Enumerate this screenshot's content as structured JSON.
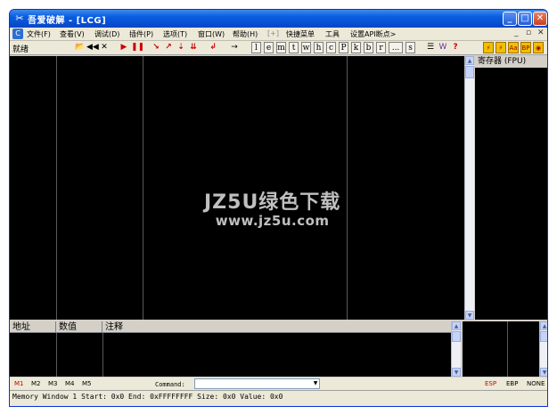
{
  "window": {
    "title": "吾爱破解 - [LCG]",
    "controls": {
      "minimize": "_",
      "maximize": "□",
      "close": "✕"
    }
  },
  "menu": {
    "items": [
      "文件(F)",
      "查看(V)",
      "调试(D)",
      "插件(P)",
      "选项(T)",
      "窗口(W)",
      "帮助(H)",
      "[+]",
      "快捷菜单",
      "工具",
      "设置API断点>"
    ],
    "mdi": [
      "_",
      "▫",
      "✕"
    ]
  },
  "toolbar": {
    "status": "就绪",
    "buttons": [
      "📂",
      "◀◀",
      "✕",
      "▶",
      "❚❚",
      "↘",
      "↗",
      "⇣",
      "⇊",
      "↲",
      "→",
      "l",
      "e",
      "m",
      "t",
      "w",
      "h",
      "c",
      "P",
      "k",
      "b",
      "r",
      "...",
      "s",
      "☰",
      "W",
      "?"
    ],
    "right_buttons": [
      "⚡",
      "⚡",
      "Aa",
      "BP",
      "◉"
    ]
  },
  "registers": {
    "header": "寄存器 (FPU)"
  },
  "dump": {
    "columns": [
      "地址",
      "数值",
      "注释"
    ]
  },
  "watermark": {
    "line1": "JZ5U绿色下载",
    "line2": "www.jz5u.com"
  },
  "bottom": {
    "memory_tabs": [
      "M1",
      "M2",
      "M3",
      "M4",
      "M5"
    ],
    "command_label": "Command:",
    "command_value": "",
    "register_selectors": [
      "ESP",
      "EBP",
      "NONE"
    ]
  },
  "status_line": "Memory Window 1  Start: 0x0  End: 0xFFFFFFFF  Size: 0x0 Value: 0x0",
  "colors": {
    "accent": "#0a5ce0",
    "active_selector": "#cc0000",
    "pane_bg": "#000000"
  }
}
